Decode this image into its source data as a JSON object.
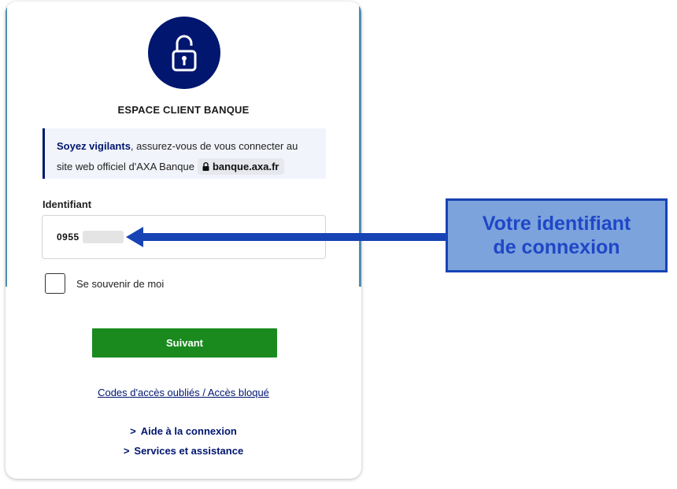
{
  "header": {
    "title": "ESPACE CLIENT BANQUE"
  },
  "warning": {
    "strong": "Soyez vigilants",
    "text_after": ", assurez-vous de vous connecter au",
    "line2": "site web officiel d'AXA Banque",
    "url": "banque.axa.fr"
  },
  "form": {
    "identifier_label": "Identifiant",
    "identifier_value": "0955",
    "remember_label": "Se souvenir de moi",
    "next_button": "Suivant"
  },
  "links": {
    "forgot": "Codes d'accès oubliés / Accès bloqué",
    "help": "Aide à la connexion",
    "services": "Services et assistance"
  },
  "annotation": {
    "line1": "Votre identifiant",
    "line2": "de connexion"
  },
  "colors": {
    "brand": "#00166f",
    "button": "#1a8a1e",
    "callout_bg": "#7ca3dc",
    "callout_text": "#1f47c6"
  },
  "icons": {
    "lock": "lock-open-icon",
    "url_lock": "lock-icon",
    "chevron": "chevron-right-icon"
  }
}
